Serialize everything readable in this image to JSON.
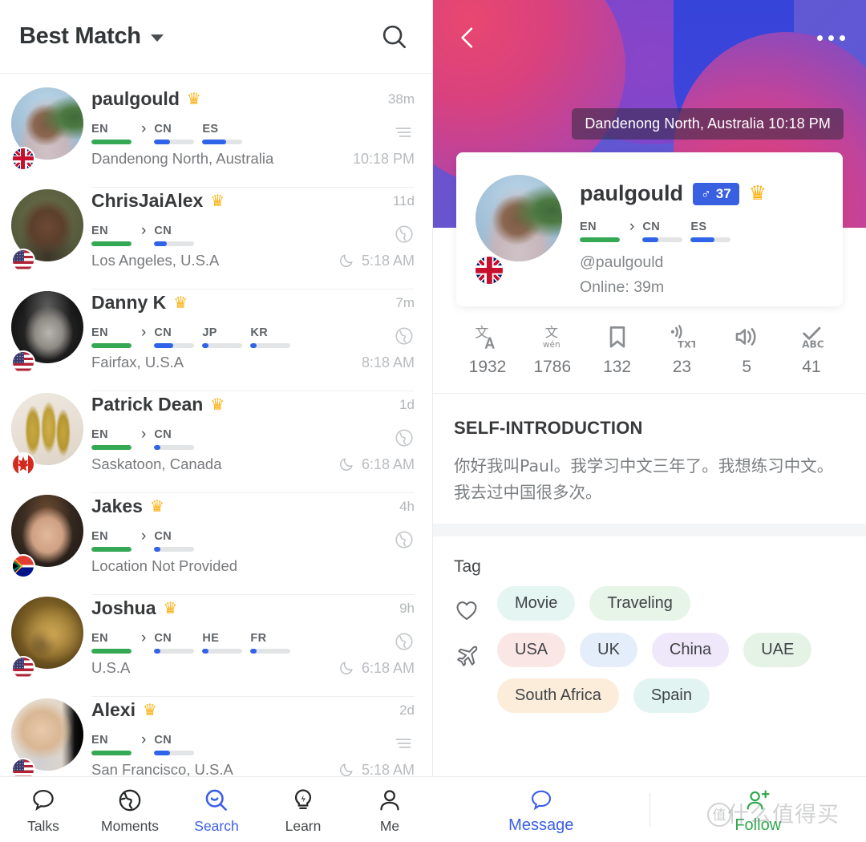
{
  "left": {
    "header": {
      "sort_label": "Best Match",
      "search_icon": "search-icon",
      "caret_icon": "chevron-down-icon"
    },
    "rows": [
      {
        "name": "paulgould",
        "crown": "♛",
        "ago": "38m",
        "location": "Dandenong North, Australia",
        "time": "10:18 PM",
        "meta_icon": "list-lines-icon",
        "night": false,
        "native": {
          "code": "EN",
          "pct": 100,
          "color": "#34a853"
        },
        "learning": [
          {
            "code": "CN",
            "pct": 40,
            "color": "#2f63e8"
          },
          {
            "code": "ES",
            "pct": 60,
            "color": "#2f63e8"
          }
        ],
        "flag": "uk",
        "avatar": "photo-man-palm"
      },
      {
        "name": "ChrisJaiAlex",
        "crown": "♛",
        "ago": "11d",
        "location": "Los Angeles, U.S.A",
        "time": "5:18 AM",
        "meta_icon": "globe-icon",
        "night": true,
        "native": {
          "code": "EN",
          "pct": 100,
          "color": "#34a853"
        },
        "learning": [
          {
            "code": "CN",
            "pct": 32,
            "color": "#2f63e8"
          }
        ],
        "flag": "usa",
        "avatar": "photo-man-green"
      },
      {
        "name": "Danny K",
        "crown": "♛",
        "ago": "7m",
        "location": "Fairfax, U.S.A",
        "time": "8:18 AM",
        "meta_icon": "globe-icon",
        "night": false,
        "native": {
          "code": "EN",
          "pct": 100,
          "color": "#34a853"
        },
        "learning": [
          {
            "code": "CN",
            "pct": 48,
            "color": "#2f63e8"
          },
          {
            "code": "JP",
            "pct": 16,
            "color": "#2f63e8"
          },
          {
            "code": "KR",
            "pct": 16,
            "color": "#2f63e8"
          }
        ],
        "flag": "usa",
        "avatar": "photo-man-bw"
      },
      {
        "name": "Patrick Dean",
        "crown": "♛",
        "ago": "1d",
        "location": "Saskatoon, Canada",
        "time": "6:18 AM",
        "meta_icon": "globe-icon",
        "night": true,
        "native": {
          "code": "EN",
          "pct": 100,
          "color": "#34a853"
        },
        "learning": [
          {
            "code": "CN",
            "pct": 16,
            "color": "#2f63e8"
          }
        ],
        "flag": "canada",
        "avatar": "photo-wheat"
      },
      {
        "name": "Jakes",
        "crown": "♛",
        "ago": "4h",
        "location": "Location Not Provided",
        "time": "",
        "meta_icon": "globe-icon",
        "night": false,
        "native": {
          "code": "EN",
          "pct": 100,
          "color": "#34a853"
        },
        "learning": [
          {
            "code": "CN",
            "pct": 16,
            "color": "#2f63e8"
          }
        ],
        "flag": "southafrica",
        "avatar": "photo-man-brown"
      },
      {
        "name": "Joshua",
        "crown": "♛",
        "ago": "9h",
        "location": "U.S.A",
        "time": "6:18 AM",
        "meta_icon": "globe-icon",
        "night": true,
        "native": {
          "code": "EN",
          "pct": 100,
          "color": "#34a853"
        },
        "learning": [
          {
            "code": "CN",
            "pct": 16,
            "color": "#2f63e8"
          },
          {
            "code": "HE",
            "pct": 16,
            "color": "#2f63e8"
          },
          {
            "code": "FR",
            "pct": 16,
            "color": "#2f63e8"
          }
        ],
        "flag": "usa",
        "avatar": "photo-blur-gold"
      },
      {
        "name": "Alexi",
        "crown": "♛",
        "ago": "2d",
        "location": "San Francisco, U.S.A",
        "time": "5:18 AM",
        "meta_icon": "list-lines-icon",
        "night": true,
        "native": {
          "code": "EN",
          "pct": 100,
          "color": "#34a853"
        },
        "learning": [
          {
            "code": "CN",
            "pct": 40,
            "color": "#2f63e8"
          }
        ],
        "flag": "usa",
        "avatar": "photo-glasses"
      }
    ],
    "tabs": [
      {
        "label": "Talks",
        "icon": "speech-bubble-icon",
        "active": false
      },
      {
        "label": "Moments",
        "icon": "globe-icon",
        "active": false
      },
      {
        "label": "Search",
        "icon": "search-smile-icon",
        "active": true
      },
      {
        "label": "Learn",
        "icon": "lightbulb-bolt-icon",
        "active": false
      },
      {
        "label": "Me",
        "icon": "person-icon",
        "active": false
      }
    ]
  },
  "right": {
    "hero": {
      "back_icon": "chevron-left-icon",
      "more_icon": "more-dots-icon",
      "location_time": "Dandenong North, Australia  10:18 PM"
    },
    "profile": {
      "name": "paulgould",
      "gender_symbol": "♂",
      "age": "37",
      "crown": "♛",
      "handle": "@paulgould",
      "online": "Online: 39m",
      "native": {
        "code": "EN",
        "pct": 100,
        "color": "#34a853"
      },
      "learning": [
        {
          "code": "CN",
          "pct": 40,
          "color": "#2f63e8"
        },
        {
          "code": "ES",
          "pct": 60,
          "color": "#2f63e8"
        }
      ],
      "flag": "uk"
    },
    "stats": [
      {
        "icon": "translate-icon",
        "value": "1932"
      },
      {
        "icon": "pinyin-icon",
        "value": "1786"
      },
      {
        "icon": "bookmark-icon",
        "value": "132"
      },
      {
        "icon": "voice-to-text-icon",
        "value": "23"
      },
      {
        "icon": "speaker-icon",
        "value": "5"
      },
      {
        "icon": "spellcheck-icon",
        "value": "41"
      }
    ],
    "self_intro": {
      "title": "SELF-INTRODUCTION",
      "text": "你好我叫Paul。我学习中文三年了。我想练习中文。我去过中国很多次。"
    },
    "tag": {
      "title": "Tag",
      "groups": [
        {
          "icon": "heart-icon",
          "pills": [
            {
              "label": "Movie",
              "bg": "#e4f5f2"
            },
            {
              "label": "Traveling",
              "bg": "#e7f4e8"
            }
          ]
        },
        {
          "icon": "airplane-icon",
          "pills": [
            {
              "label": "USA",
              "bg": "#fbe6e6"
            },
            {
              "label": "UK",
              "bg": "#e4eefa"
            },
            {
              "label": "China",
              "bg": "#eee8fa"
            },
            {
              "label": "UAE",
              "bg": "#e5f3e6"
            },
            {
              "label": "South Africa",
              "bg": "#fceddb"
            },
            {
              "label": "Spain",
              "bg": "#e2f4f2"
            }
          ]
        }
      ]
    },
    "actions": [
      {
        "label": "Message",
        "icon": "speech-bubble-icon",
        "color": "#3b5ee8"
      },
      {
        "label": "Follow",
        "icon": "person-add-icon",
        "color": "#2fa84f"
      }
    ],
    "watermark": {
      "text": "什么值得买",
      "seal": "值"
    }
  },
  "colors": {
    "accent_blue": "#3b5ee8",
    "accent_green": "#2fa84f",
    "crown_gold": "#fcb215",
    "native_green": "#34a853",
    "learn_blue": "#2f63e8"
  }
}
